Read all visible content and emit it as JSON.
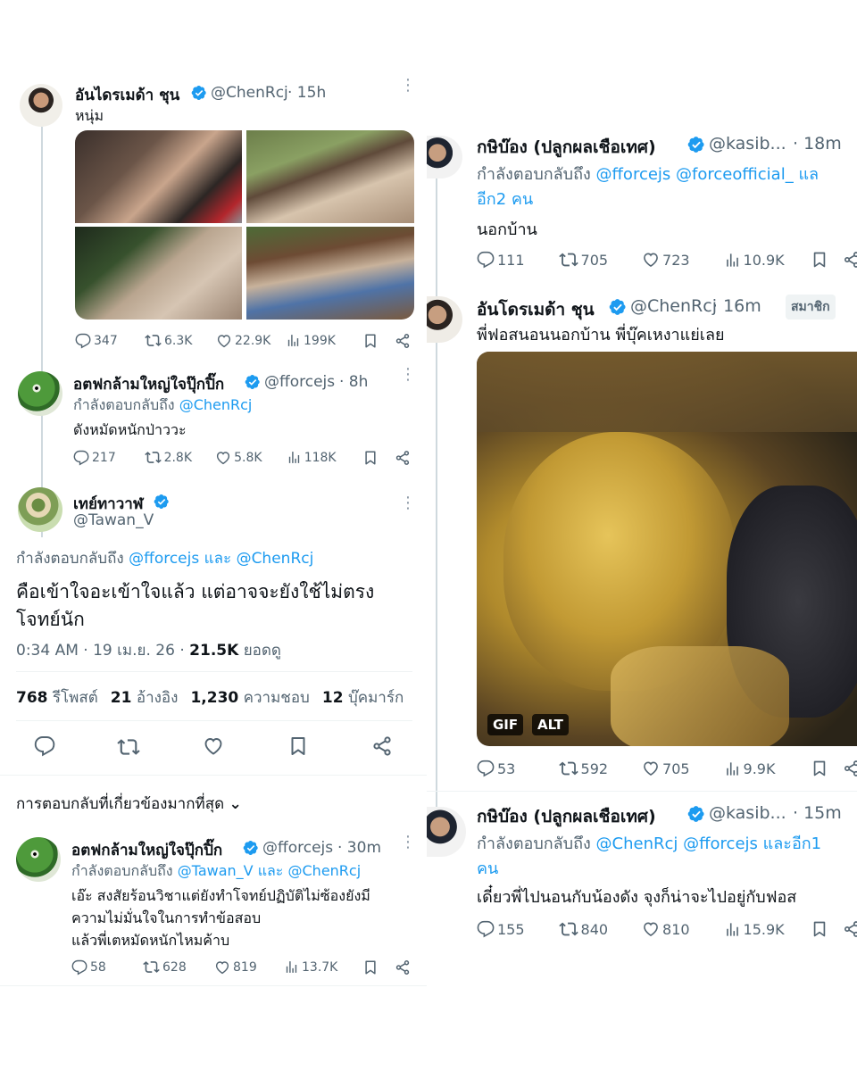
{
  "left": {
    "tweet1": {
      "display_name": "อันไดรเมด้า ชุน",
      "handle": "@ChenRcj",
      "time": "· 15h",
      "text": "หนุ่ม",
      "stats": {
        "replies": "347",
        "retweets": "6.3K",
        "likes": "22.9K",
        "views": "199K"
      }
    },
    "tweet2": {
      "display_name": "อตฟกล้ามใหญ่ใจปุ๊กปิ๊ก",
      "handle": "@fforcejs",
      "time": "· 8h",
      "reply_prefix": "กำลังตอบกลับถึง",
      "reply_to": "@ChenRcj",
      "text": "ดังหมัดหนักป่าววะ",
      "stats": {
        "replies": "217",
        "retweets": "2.8K",
        "likes": "5.8K",
        "views": "118K"
      }
    },
    "tweet3": {
      "display_name": "เทย์ทาวาฬ",
      "handle": "@Tawan_V",
      "reply_prefix": "กำลังตอบกลับถึง",
      "reply_to_1": "@fforcejs",
      "reply_and": "และ",
      "reply_to_2": "@ChenRcj",
      "text_line1": "คือเข้าใจอะเข้าใจแล้ว แต่อาจจะยังใช้ไม่ตรง",
      "text_line2": "โจทย์นัก",
      "meta": "0:34 AM · 19 เม.ย. 26 ·",
      "views_count": "21.5K",
      "views_label": "ยอดดู",
      "counts": [
        {
          "num": "768",
          "label": "รีโพสต์"
        },
        {
          "num": "21",
          "label": "อ้างอิง"
        },
        {
          "num": "1,230",
          "label": "ความชอบ"
        },
        {
          "num": "12",
          "label": "บุ๊คมาร์ก"
        }
      ]
    },
    "relevant_label": "การตอบกลับที่เกี่ยวข้องมากที่สุด",
    "tweet4": {
      "display_name": "อตฟกล้ามใหญ่ใจปุ๊กปิ๊ก",
      "handle": "@fforcejs",
      "time": "· 30m",
      "reply_prefix": "กำลังตอบกลับถึง",
      "reply_to_1": "@Tawan_V",
      "reply_and": "และ",
      "reply_to_2": "@ChenRcj",
      "text_line1": "เอ๊ะ สงสัยร้อนวิชาแต่ยังทำโจทย์ปฏิบัติไม่ซ้องยังมี",
      "text_line2": "ความไม่มั่นใจในการทำข้อสอบ",
      "text_line3": "แล้วพี่เตหมัดหนักไหมค้าบ",
      "stats": {
        "replies": "58",
        "retweets": "628",
        "likes": "819",
        "views": "13.7K"
      }
    }
  },
  "right": {
    "tweet1": {
      "display_name": "กษิบ๊อง (ปลูกผลเชือเทศ)",
      "handle": "@kasib...",
      "time": "· 18m",
      "reply_prefix": "กำลังตอบกลับถึง",
      "reply_to_1": "@fforcejs",
      "reply_to_2": "@forceofficial_",
      "reply_tail": "แล",
      "reply_line2": "อีก2 คน",
      "text": "นอกบ้าน",
      "stats": {
        "replies": "111",
        "retweets": "705",
        "likes": "723",
        "views": "10.9K"
      }
    },
    "tweet2": {
      "display_name": "อันโดรเมด้า ชุน",
      "handle": "@ChenRcj",
      "time": "· 16m",
      "member_badge": "สมาชิก",
      "text": "พี่ฟอสนอนนอกบ้าน พี่บุ๊คเหงาแย่เลย",
      "gif_label": "GIF",
      "alt_label": "ALT",
      "stats": {
        "replies": "53",
        "retweets": "592",
        "likes": "705",
        "views": "9.9K"
      }
    },
    "tweet3": {
      "display_name": "กษิบ๊อง (ปลูกผลเชือเทศ)",
      "handle": "@kasib...",
      "time": "· 15m",
      "reply_prefix": "กำลังตอบกลับถึง",
      "reply_to_1": "@ChenRcj",
      "reply_to_2": "@fforcejs",
      "reply_tail": "และอีก1",
      "reply_line2": "คน",
      "text": "เดี๋ยวพี่ไปนอนกับน้องดัง จุงก็น่าจะไปอยู่กับฟอส",
      "stats": {
        "replies": "155",
        "retweets": "840",
        "likes": "810",
        "views": "15.9K"
      }
    }
  },
  "colors": {
    "accent": "#1d9bf0",
    "text": "#0f1419",
    "muted": "#536471",
    "border": "#eff3f4"
  }
}
